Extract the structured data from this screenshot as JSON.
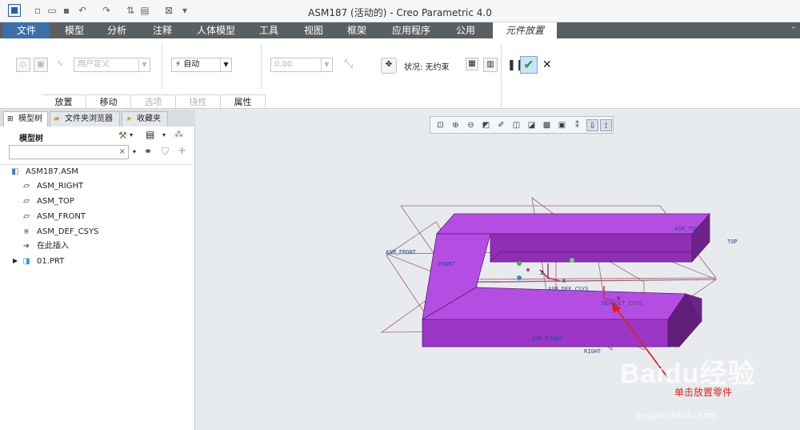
{
  "window": {
    "title": "ASM187 (活动的) - Creo Parametric 4.0"
  },
  "quick_access": [
    "app-icon",
    "new-icon",
    "open-icon",
    "save-icon",
    "undo-icon",
    "redo-icon",
    "regen-icon",
    "windows-icon",
    "close-icon",
    "more-icon"
  ],
  "ribbon": {
    "tabs": [
      "文件",
      "模型",
      "分析",
      "注释",
      "人体模型",
      "工具",
      "视图",
      "框架",
      "应用程序",
      "公用"
    ],
    "active_tab": "元件放置",
    "constraint_combo": "用户定义",
    "auto_combo": "自动",
    "offset_combo": "0.00",
    "status_text": "状况: 无约束",
    "subtabs": [
      "放置",
      "移动",
      "选项",
      "挠性",
      "属性"
    ]
  },
  "left_panel": {
    "tabs": [
      "模型树",
      "文件夹浏览器",
      "收藏夹"
    ],
    "tree_title": "模型树",
    "search_value": "",
    "items": [
      {
        "label": "ASM187.ASM",
        "icon": "assembly-icon"
      },
      {
        "label": "ASM_RIGHT",
        "icon": "datum-plane-icon"
      },
      {
        "label": "ASM_TOP",
        "icon": "datum-plane-icon"
      },
      {
        "label": "ASM_FRONT",
        "icon": "datum-plane-icon"
      },
      {
        "label": "ASM_DEF_CSYS",
        "icon": "csys-icon"
      },
      {
        "label": "在此插入",
        "icon": "insert-arrow-icon"
      },
      {
        "label": "01.PRT",
        "icon": "part-icon"
      }
    ]
  },
  "viewport": {
    "labels": {
      "asm_top": "ASM_TOP",
      "top": "TOP",
      "asm_front": "ASM_FRONT",
      "front": "FRONT",
      "asm_def": "ASM_DEF_CSYS",
      "default_csys": "DEFAULT_CSYS",
      "asm_right": "ASM_RIGHT",
      "right": "RIGHT",
      "x1": "X",
      "x2": "X",
      "z1": "Z"
    },
    "annotation": "单击放置零件",
    "watermark": "Baidu经验",
    "watermark_url": "jingyan.baidu.com",
    "part_color": "#a93fd8"
  },
  "colors": {
    "file_tab": "#3b6fa8",
    "ribbon_tabs_bg": "#5a5f64",
    "accept": "#2b9b38",
    "annotation": "#e02020"
  }
}
